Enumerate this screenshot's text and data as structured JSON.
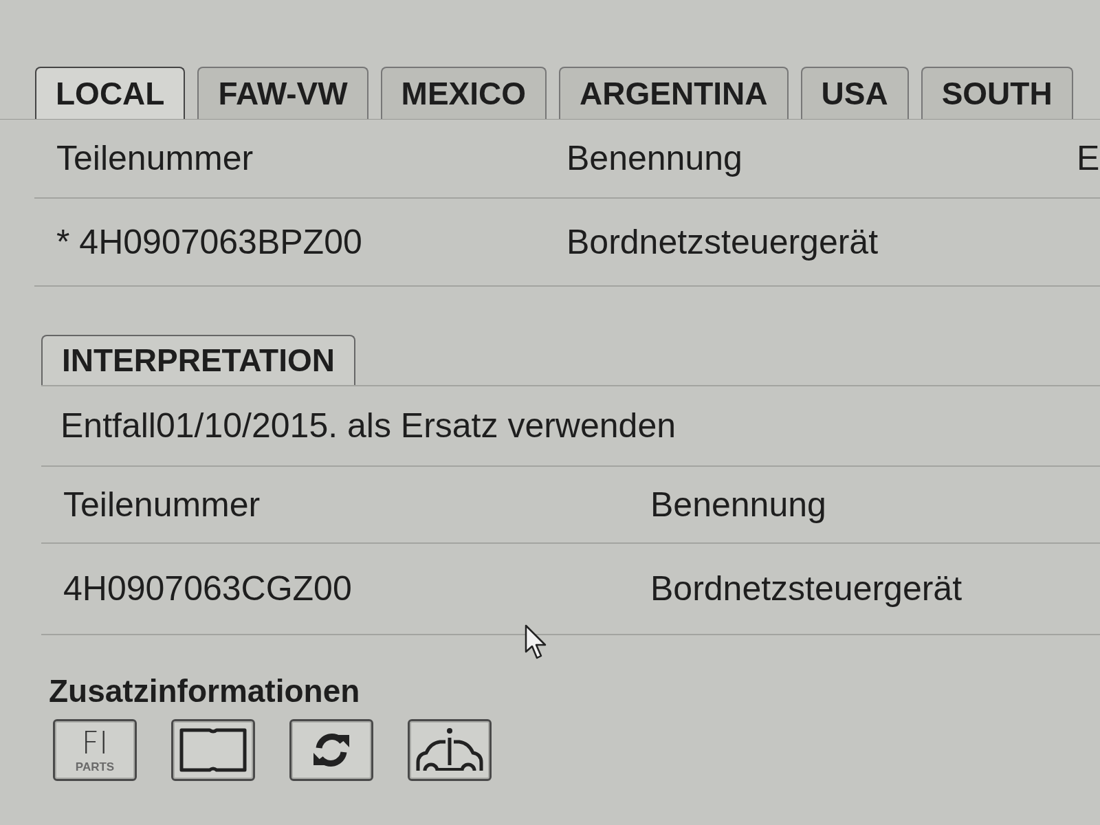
{
  "tabs": [
    {
      "label": "LOCAL",
      "selected": true
    },
    {
      "label": "FAW-VW",
      "selected": false
    },
    {
      "label": "MEXICO",
      "selected": false
    },
    {
      "label": "ARGENTINA",
      "selected": false
    },
    {
      "label": "USA",
      "selected": false
    },
    {
      "label": "SOUTH",
      "selected": false
    }
  ],
  "parts_table": {
    "columns": [
      "Teilenummer",
      "Benennung",
      "E"
    ],
    "rows": [
      [
        "* 4H0907063BPZ00",
        "Bordnetzsteuergerät"
      ]
    ]
  },
  "interpretation": {
    "tab": "INTERPRETATION",
    "note": "Entfall01/10/2015. als Ersatz verwenden",
    "columns": [
      "Teilenummer",
      "Benennung"
    ],
    "rows": [
      [
        "4H0907063CGZ00",
        "Bordnetzsteuergerät"
      ]
    ]
  },
  "additional_info": {
    "title": "Zusatzinformationen",
    "buttons": [
      {
        "kind": "parts",
        "label": "FI",
        "sublabel": "PARTS"
      },
      {
        "kind": "book"
      },
      {
        "kind": "refresh"
      },
      {
        "kind": "car_info"
      }
    ]
  }
}
